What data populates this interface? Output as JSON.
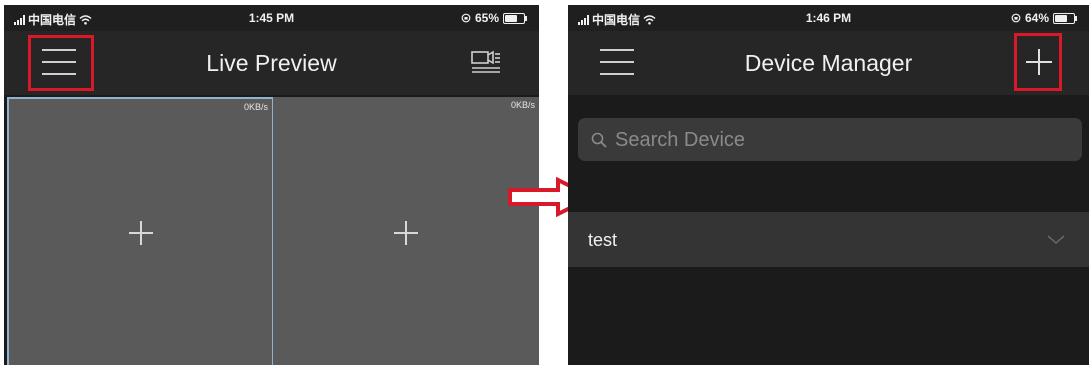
{
  "left_screen": {
    "status": {
      "carrier": "中国电信",
      "time": "1:45 PM",
      "battery": "65%",
      "battery_fraction": 0.65
    },
    "nav": {
      "title": "Live Preview"
    },
    "cells": [
      {
        "speed": "0KB/s",
        "selected": true
      },
      {
        "speed": "0KB/s",
        "selected": false
      }
    ]
  },
  "right_screen": {
    "status": {
      "carrier": "中国电信",
      "time": "1:46 PM",
      "battery": "64%",
      "battery_fraction": 0.64
    },
    "nav": {
      "title": "Device Manager"
    },
    "search": {
      "placeholder": "Search Device"
    },
    "devices": [
      {
        "name": "test"
      }
    ]
  },
  "colors": {
    "background": "#1b1b1b",
    "nav_bar": "#262626",
    "video_cell": "#5a5a5a",
    "selected_border": "#8fb3d0",
    "highlight": "#d7192a",
    "device_row": "#343434"
  },
  "icons": {
    "menu": "hamburger-icon",
    "channel_layout": "channel-layout-icon",
    "add": "plus-icon",
    "search": "search-icon",
    "expand": "chevron-down-icon",
    "transition": "right-arrow-icon"
  }
}
